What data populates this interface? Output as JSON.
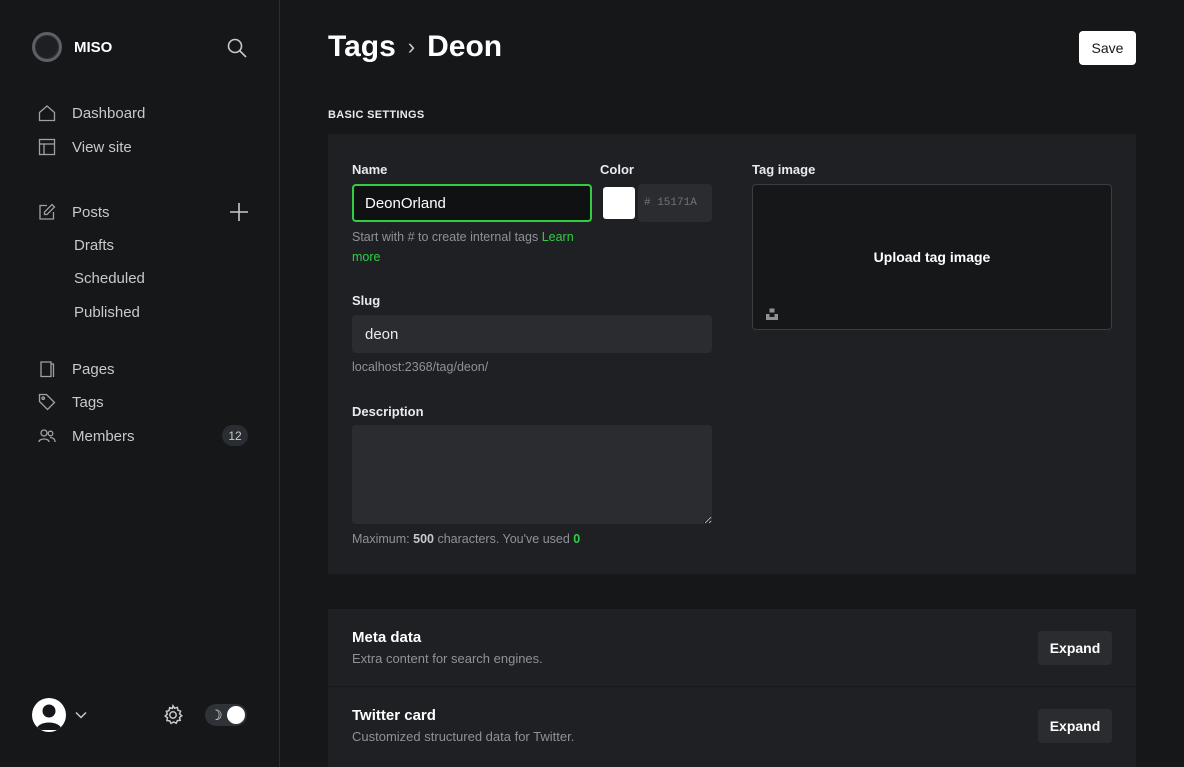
{
  "brand": {
    "name": "MISO"
  },
  "sidebar": {
    "items": [
      {
        "label": "Dashboard",
        "icon": "home-icon"
      },
      {
        "label": "View site",
        "icon": "layout-icon"
      },
      {
        "label": "Posts",
        "icon": "edit-icon"
      },
      {
        "label": "Pages",
        "icon": "page-icon"
      },
      {
        "label": "Tags",
        "icon": "tag-icon"
      },
      {
        "label": "Members",
        "icon": "members-icon",
        "count": "12"
      }
    ],
    "post_subitems": [
      "Drafts",
      "Scheduled",
      "Published"
    ]
  },
  "header": {
    "section": "Tags",
    "separator": "›",
    "current": "Deon",
    "save_label": "Save"
  },
  "basic": {
    "section_label": "BASIC SETTINGS",
    "name_label": "Name",
    "name_value": "DeonOrland",
    "name_hint": "Start with # to create internal tags ",
    "name_hint_link": "Learn more",
    "color_label": "Color",
    "color_value": "# 15171A",
    "swatch_color": "#ffffff",
    "slug_label": "Slug",
    "slug_value": "deon",
    "slug_url": "localhost:2368/tag/deon/",
    "description_label": "Description",
    "description_value": "",
    "desc_hint_prefix": "Maximum: ",
    "desc_hint_max": "500",
    "desc_hint_mid": " characters. You've used ",
    "desc_hint_used": "0",
    "tag_image_label": "Tag image",
    "upload_label": "Upload tag image"
  },
  "cards": [
    {
      "title": "Meta data",
      "desc": "Extra content for search engines.",
      "button": "Expand"
    },
    {
      "title": "Twitter card",
      "desc": "Customized structured data for Twitter.",
      "button": "Expand"
    }
  ],
  "colors": {
    "accent": "#30cf43",
    "background": "#151719",
    "panel": "#1e2024"
  }
}
